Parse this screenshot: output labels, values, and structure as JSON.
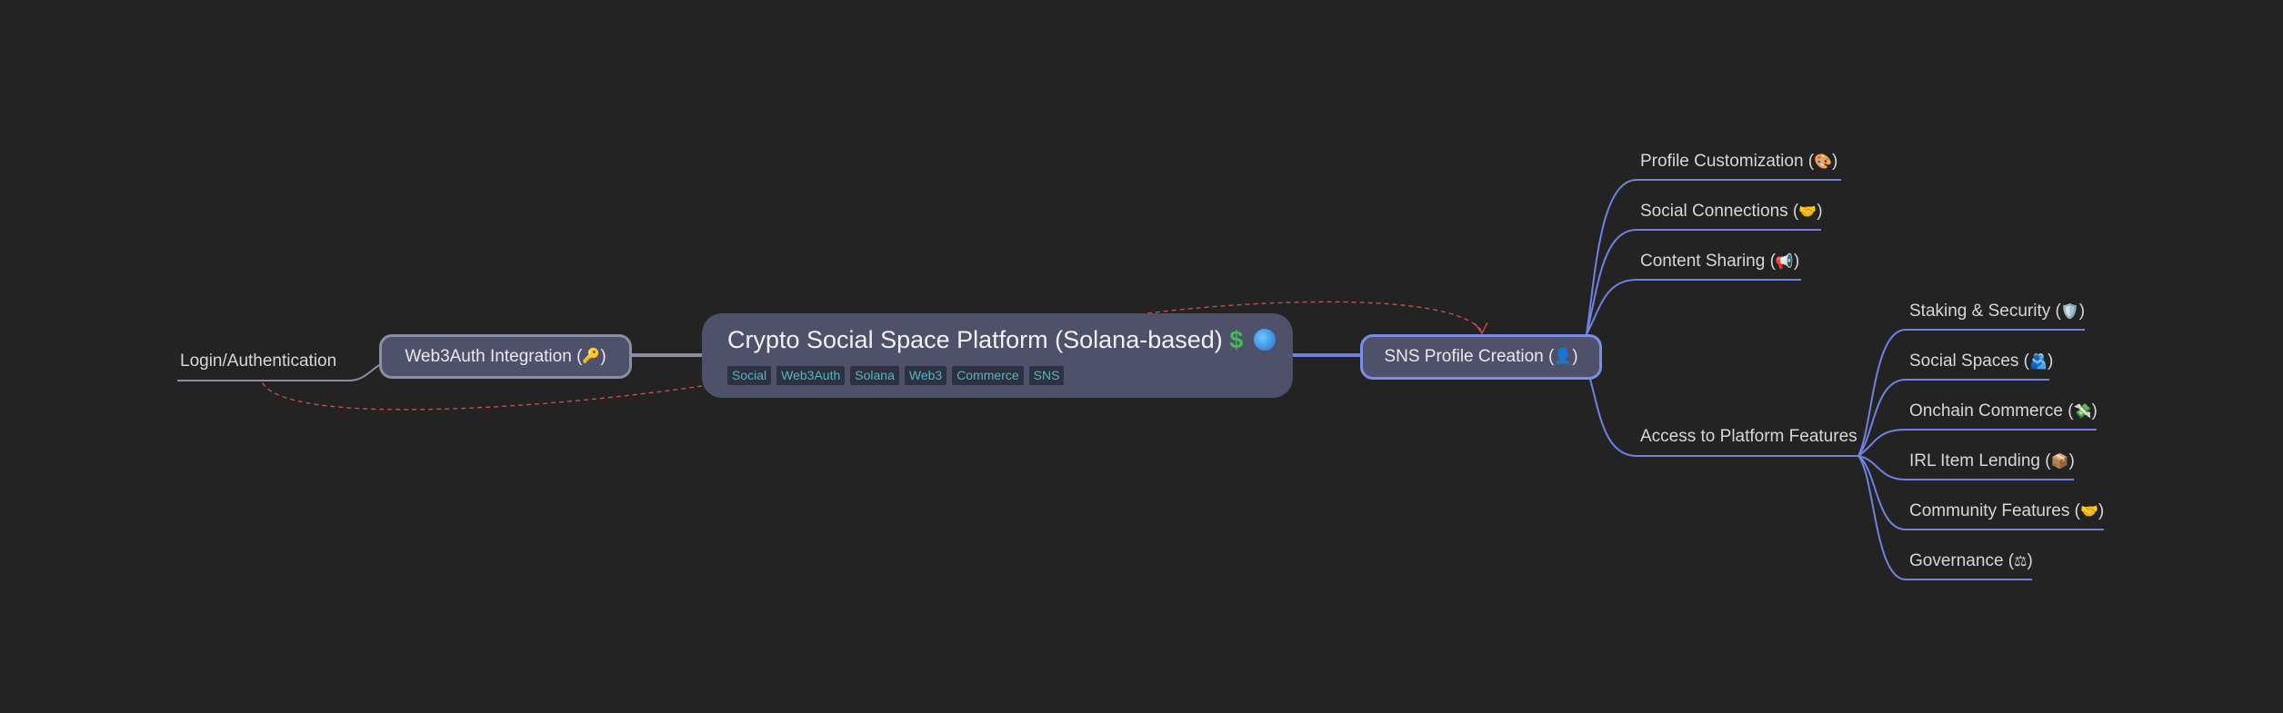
{
  "root": {
    "title": "Crypto Social Space Platform (Solana-based)",
    "emoji_dollar": "$",
    "tags": [
      "Social",
      "Web3Auth",
      "Solana",
      "Web3",
      "Commerce",
      "SNS"
    ]
  },
  "left": {
    "web3auth": {
      "label": "Web3Auth Integration (",
      "emoji": "🔑",
      "close": ")"
    },
    "login": {
      "label": "Login/Authentication"
    }
  },
  "right": {
    "sns": {
      "label": "SNS Profile Creation (",
      "emoji": "👤",
      "close": ")"
    },
    "children": [
      {
        "label": "Profile Customization (",
        "emoji": "🎨",
        "close": ")"
      },
      {
        "label": "Social Connections (",
        "emoji": "🤝",
        "close": ")"
      },
      {
        "label": "Content Sharing (",
        "emoji": "📢",
        "close": ")"
      },
      {
        "label": "Access to Platform Features",
        "emoji": "",
        "close": ""
      }
    ],
    "features": [
      {
        "label": "Staking & Security (",
        "emoji": "🛡️",
        "close": ")"
      },
      {
        "label": "Social Spaces (",
        "emoji": "🫂",
        "close": ")"
      },
      {
        "label": "Onchain Commerce (",
        "emoji": "💸",
        "close": ")"
      },
      {
        "label": "IRL Item Lending (",
        "emoji": "📦",
        "close": ")"
      },
      {
        "label": "Community Features (",
        "emoji": "🤝",
        "close": ")"
      },
      {
        "label": "Governance (",
        "emoji": "⚖",
        "close": ")"
      }
    ]
  },
  "colors": {
    "background": "#232323",
    "node_fill": "#4f5069",
    "link_blue": "#6f82e0",
    "link_gray": "#8c8ea3",
    "relation_red": "#c0504d",
    "tag_text": "#4fb6c9",
    "text": "#d7d7d7"
  }
}
